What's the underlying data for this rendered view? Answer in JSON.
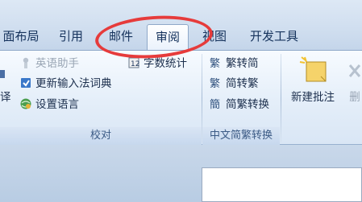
{
  "tabs": [
    {
      "label": "面布局"
    },
    {
      "label": "引用"
    },
    {
      "label": "邮件"
    },
    {
      "label": "审阅",
      "active": true
    },
    {
      "label": "视图"
    },
    {
      "label": "开发工具"
    }
  ],
  "proofing": {
    "items": [
      {
        "label": "英语助手",
        "disabled": true
      },
      {
        "label": "更新输入法词典"
      },
      {
        "label": "设置语言"
      }
    ],
    "partial_left_label": "译",
    "word_count": "字数统计",
    "group_label": "校对"
  },
  "chinese_conversion": {
    "items": [
      {
        "label": "繁转简"
      },
      {
        "label": "简转繁"
      },
      {
        "label": "简繁转换"
      }
    ],
    "group_label": "中文简繁转换"
  },
  "comments": {
    "new_comment": "新建批注",
    "delete_partial": "删"
  },
  "annotation_color": "#e63b3b",
  "accent_color": "#15325c"
}
